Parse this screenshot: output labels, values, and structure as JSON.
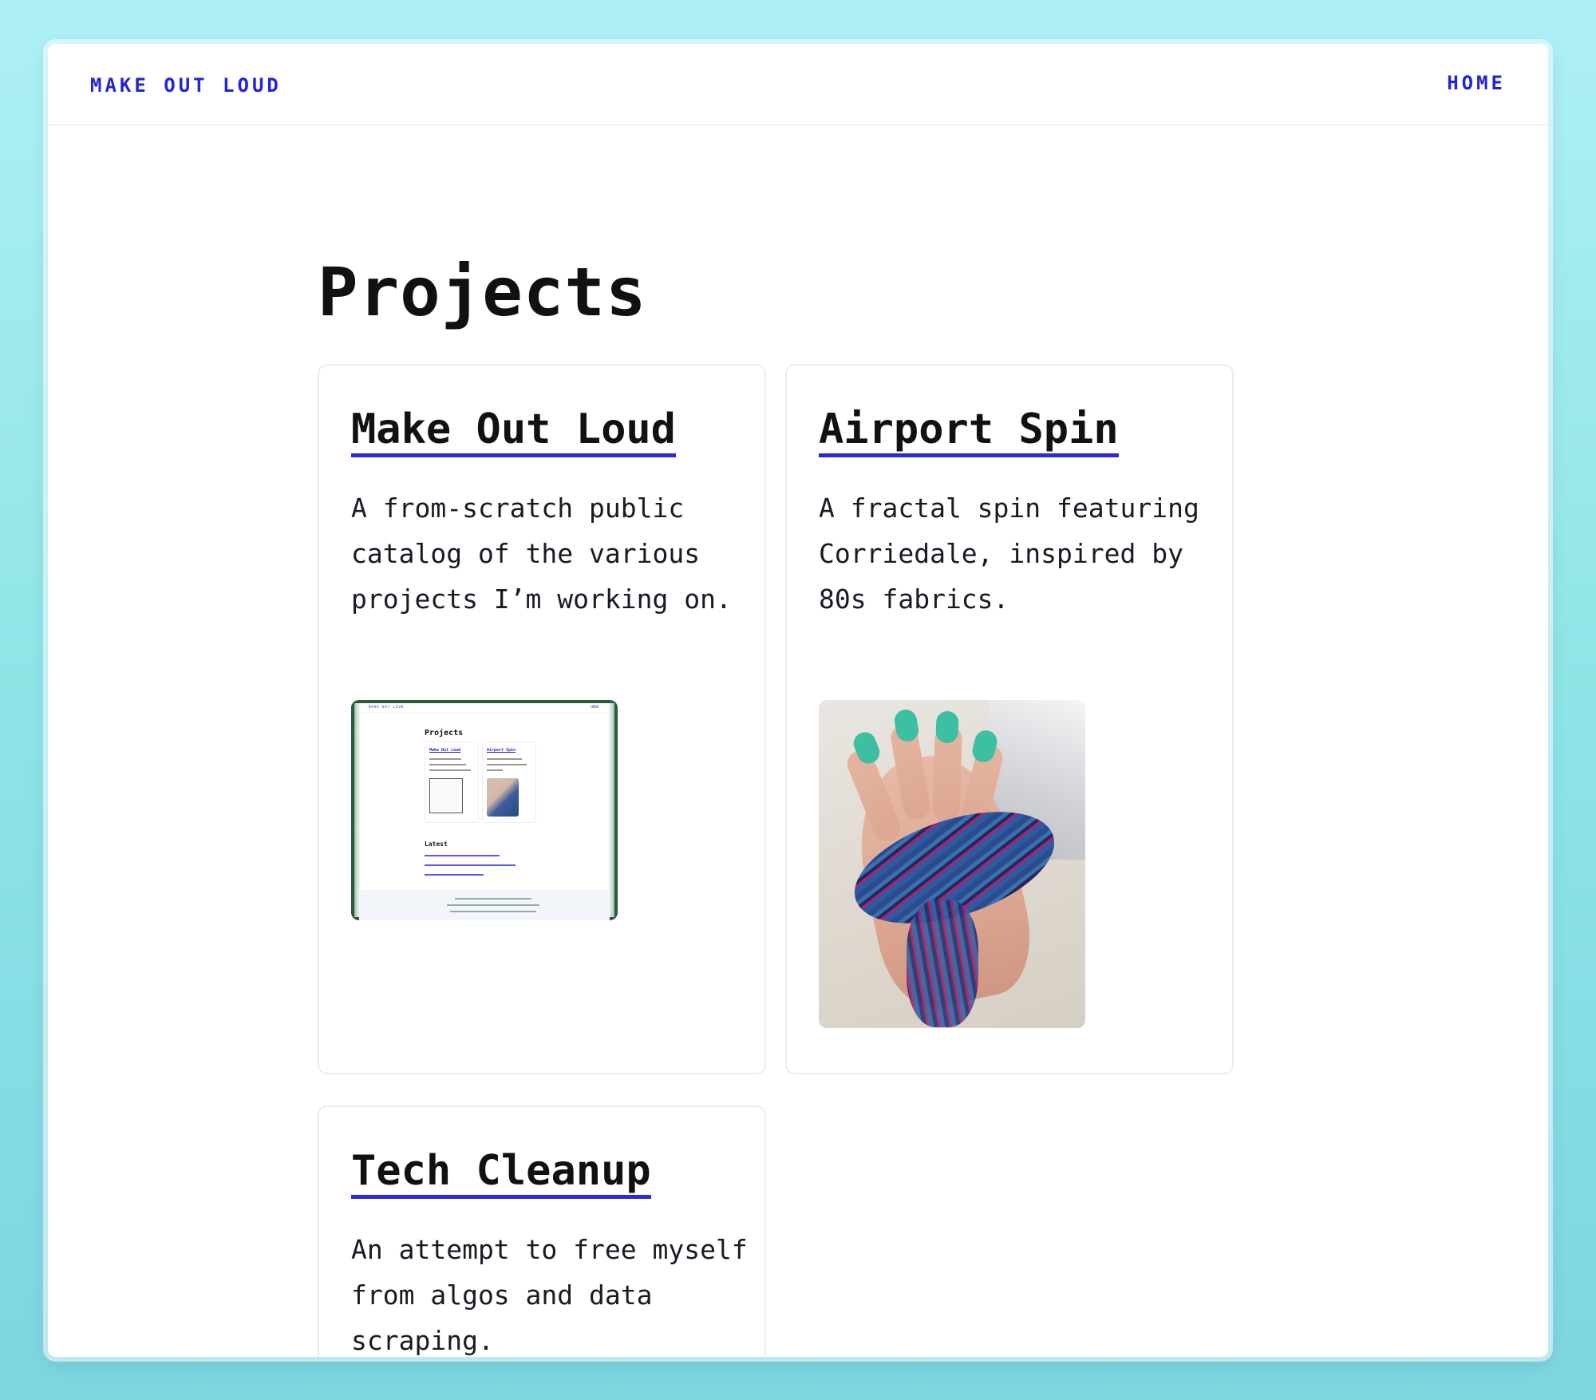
{
  "header": {
    "brand": "MAKE OUT LOUD",
    "nav_home": "HOME"
  },
  "main": {
    "title": "Projects",
    "projects": [
      {
        "title": "Make Out Loud",
        "description": "A from-scratch public catalog of the various projects I’m working on.",
        "image": "site-screenshot"
      },
      {
        "title": "Airport Spin",
        "description": "A fractal spin featuring Corriedale, inspired by 80s fabrics.",
        "image": "yarn-on-hand-photo"
      },
      {
        "title": "Tech Cleanup",
        "description": "An attempt to free myself from algos and data scraping."
      }
    ]
  },
  "thumbnail_site": {
    "brand": "MAKE OUT LOUD",
    "home": "HOME",
    "title": "Projects",
    "card1": "Make Out Loud",
    "card2": "Airport Spin",
    "latest": "Latest"
  },
  "colors": {
    "accent": "#2323d8",
    "background_top": "#aef0f6",
    "background_bottom": "#7dd5e0",
    "nail_polish": "#3cbfa3"
  }
}
